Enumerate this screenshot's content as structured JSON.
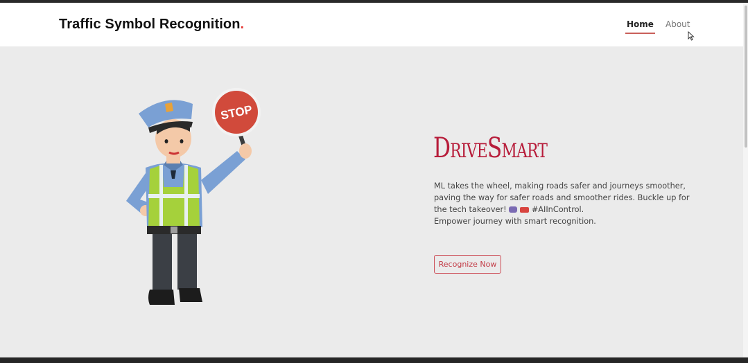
{
  "header": {
    "brand_text": "Traffic Symbol Recognition",
    "brand_dot": ".",
    "nav": [
      {
        "label": "Home",
        "active": true
      },
      {
        "label": "About",
        "active": false
      }
    ]
  },
  "hero": {
    "title": "DriveSmart",
    "line1": "ML takes the wheel, making roads safer and journeys smoother, paving the way for safer roads and smoother rides. Buckle up for the tech takeover!",
    "hashtag": "#AIInControl.",
    "line2": "Empower journey with smart recognition.",
    "button_label": "Recognize Now",
    "sign_text": "STOP"
  },
  "colors": {
    "accent": "#c23a45",
    "title": "#b71c3a",
    "background": "#ebebeb"
  },
  "icons": [
    "mouse-cursor-icon",
    "car-emoji-icon",
    "truck-emoji-icon"
  ]
}
